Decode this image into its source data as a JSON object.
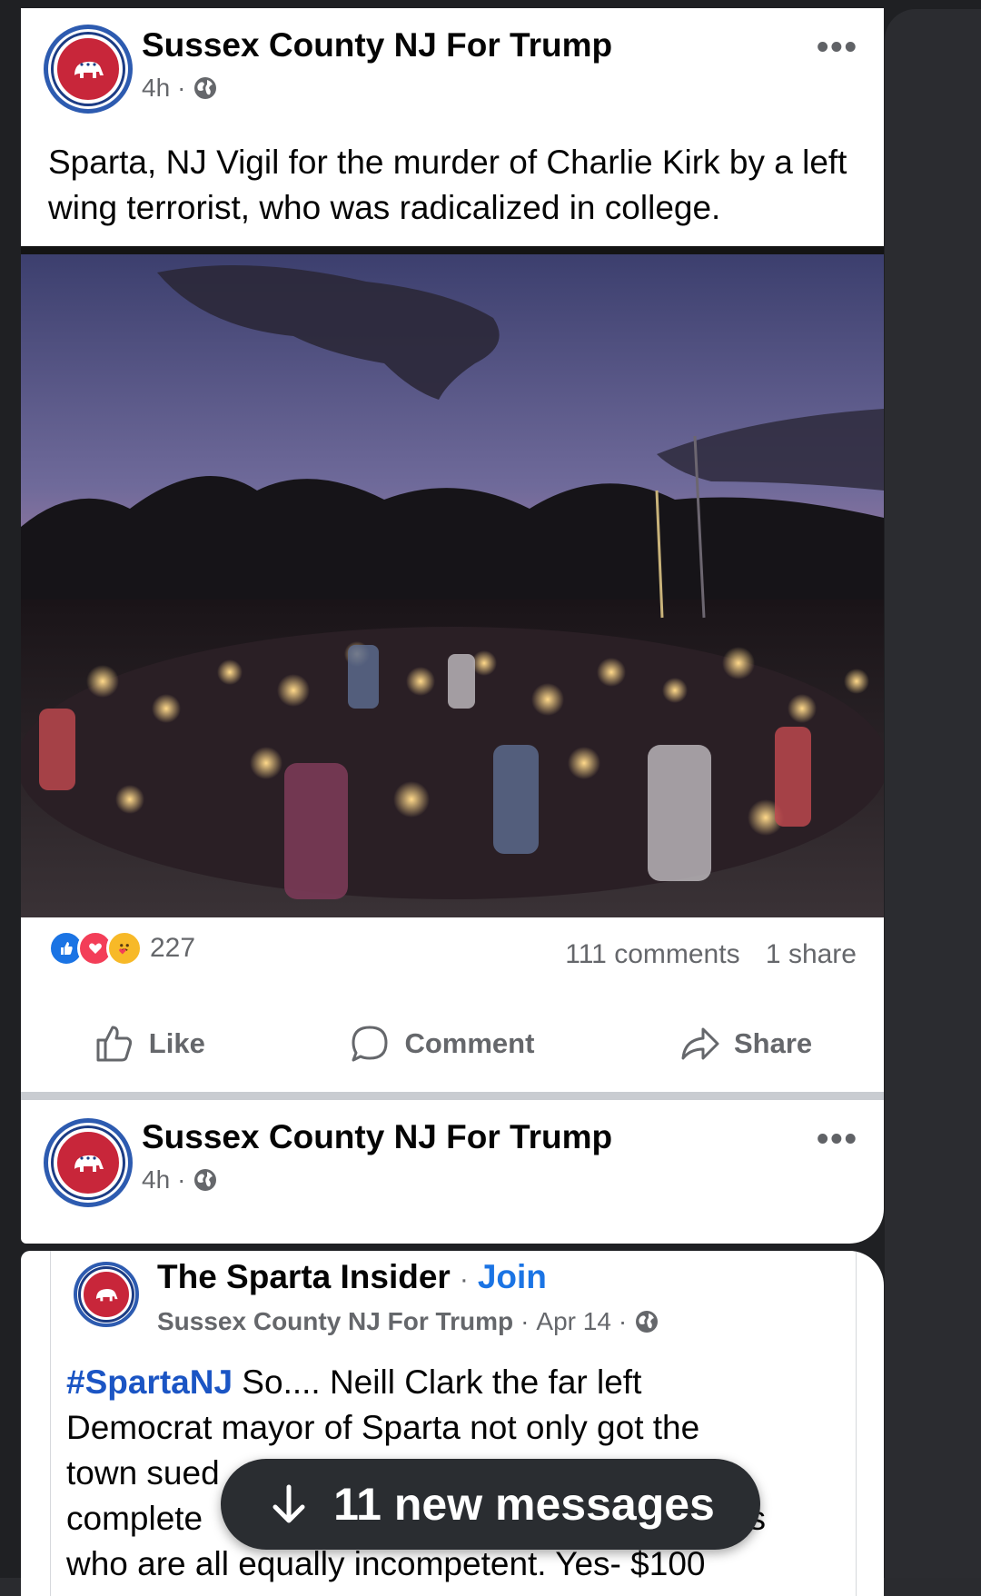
{
  "post1": {
    "page_name": "Sussex County NJ For Trump",
    "time": "4h",
    "separator": "·",
    "more": "•••",
    "text": "Sparta, NJ Vigil for the murder of Charlie Kirk by a left wing terrorist, who was radicalized in college.",
    "reactions_count": "227",
    "comments": "111 comments",
    "shares": "1 share"
  },
  "actions": {
    "like": "Like",
    "comment": "Comment",
    "share": "Share"
  },
  "post2": {
    "page_name": "Sussex County NJ For Trump",
    "time": "4h",
    "separator": "·",
    "more": "•••"
  },
  "shared_post": {
    "group_name": "The Sparta Insider",
    "separator": "·",
    "join": "Join",
    "author": "Sussex County NJ For Trump",
    "date": "Apr 14",
    "hashtag": "#SpartaNJ",
    "line1": " So.... Neill Clark the far left",
    "line2": "Democrat mayor of Sparta not only got the",
    "line3": "town sued",
    "line4": "complete",
    "line4_end": "s",
    "line5": "who are all equally incompetent. Yes- $100"
  },
  "toast": {
    "label": "11 new messages"
  },
  "icons": {
    "reaction_like": "like-reaction-icon",
    "reaction_love": "love-reaction-icon",
    "reaction_care": "care-reaction-icon",
    "globe": "globe-icon",
    "arrow_down": "arrow-down-icon"
  },
  "colors": {
    "facebook_blue": "#1b74e4",
    "text_primary": "#050505",
    "text_secondary": "#65676b",
    "toast_bg": "#2a2d31"
  }
}
